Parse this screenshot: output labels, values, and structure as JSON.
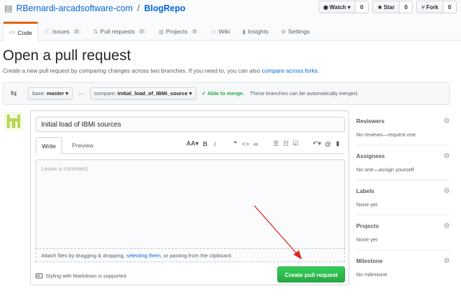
{
  "repo": {
    "owner": "RBernardi-arcadsoftware-com",
    "separator": "/",
    "name": "BlogRepo"
  },
  "actions": [
    {
      "icon": "eye-icon",
      "glyph": "◉",
      "label": "Watch ▾",
      "count": "0"
    },
    {
      "icon": "star-icon",
      "glyph": "★",
      "label": "Star",
      "count": "0"
    },
    {
      "icon": "fork-icon",
      "glyph": "⑂",
      "label": "Fork",
      "count": "0"
    }
  ],
  "tabs": [
    {
      "label": "Code",
      "icon": "code-icon",
      "glyph": "<>",
      "counter": "",
      "selected": true
    },
    {
      "label": "Issues",
      "icon": "issue-icon",
      "glyph": "ⓘ",
      "counter": "0"
    },
    {
      "label": "Pull requests",
      "icon": "pull-request-icon",
      "glyph": "⇅",
      "counter": "0"
    },
    {
      "label": "Projects",
      "icon": "project-icon",
      "glyph": "▥",
      "counter": "0"
    },
    {
      "label": "Wiki",
      "icon": "book-icon",
      "glyph": "▭",
      "counter": ""
    },
    {
      "label": "Insights",
      "icon": "graph-icon",
      "glyph": "▮",
      "counter": ""
    },
    {
      "label": "Settings",
      "icon": "gear-icon",
      "glyph": "⚙",
      "counter": ""
    }
  ],
  "page": {
    "title": "Open a pull request",
    "lead_text": "Create a new pull request by comparing changes across two branches. If you need to, you can also",
    "lead_link": "compare across forks."
  },
  "range": {
    "base_key": "base:",
    "base_value": "master ▾",
    "dots": "···",
    "compare_key": "compare:",
    "compare_value": "Initial_load_of_IBMi_source ▾",
    "merge_status": "✓ Able to merge.",
    "merge_message": "These branches can be automatically merged."
  },
  "form": {
    "title_value": "Initial load of IBMi sources",
    "tab_write": "Write",
    "tab_preview": "Preview",
    "toolbar": [
      "AA▾",
      "B",
      "i",
      "❝",
      "<>",
      "∞",
      "☰",
      "☷",
      "☑",
      "↶▾",
      "@",
      "▮"
    ],
    "comment_placeholder": "Leave a comment",
    "attach_pre": "Attach files by dragging & dropping,",
    "attach_link": "selecting them",
    "attach_post": ", or pasting from the clipboard.",
    "markdown_badge": "M↓",
    "markdown_note": "Styling with Markdown is supported",
    "submit_label": "Create pull request"
  },
  "sidebar": [
    {
      "heading": "Reviewers",
      "value": "No reviews—request one"
    },
    {
      "heading": "Assignees",
      "value": "No one—assign yourself"
    },
    {
      "heading": "Labels",
      "value": "None yet"
    },
    {
      "heading": "Projects",
      "value": "None yet"
    },
    {
      "heading": "Milestone",
      "value": "No milestone"
    }
  ],
  "colors": {
    "link": "#0366d6",
    "merge_ok": "#28a745",
    "create_button": "#2cbe4e",
    "tab_accent": "#e36209",
    "annotation_arrow": "#e0241b"
  }
}
